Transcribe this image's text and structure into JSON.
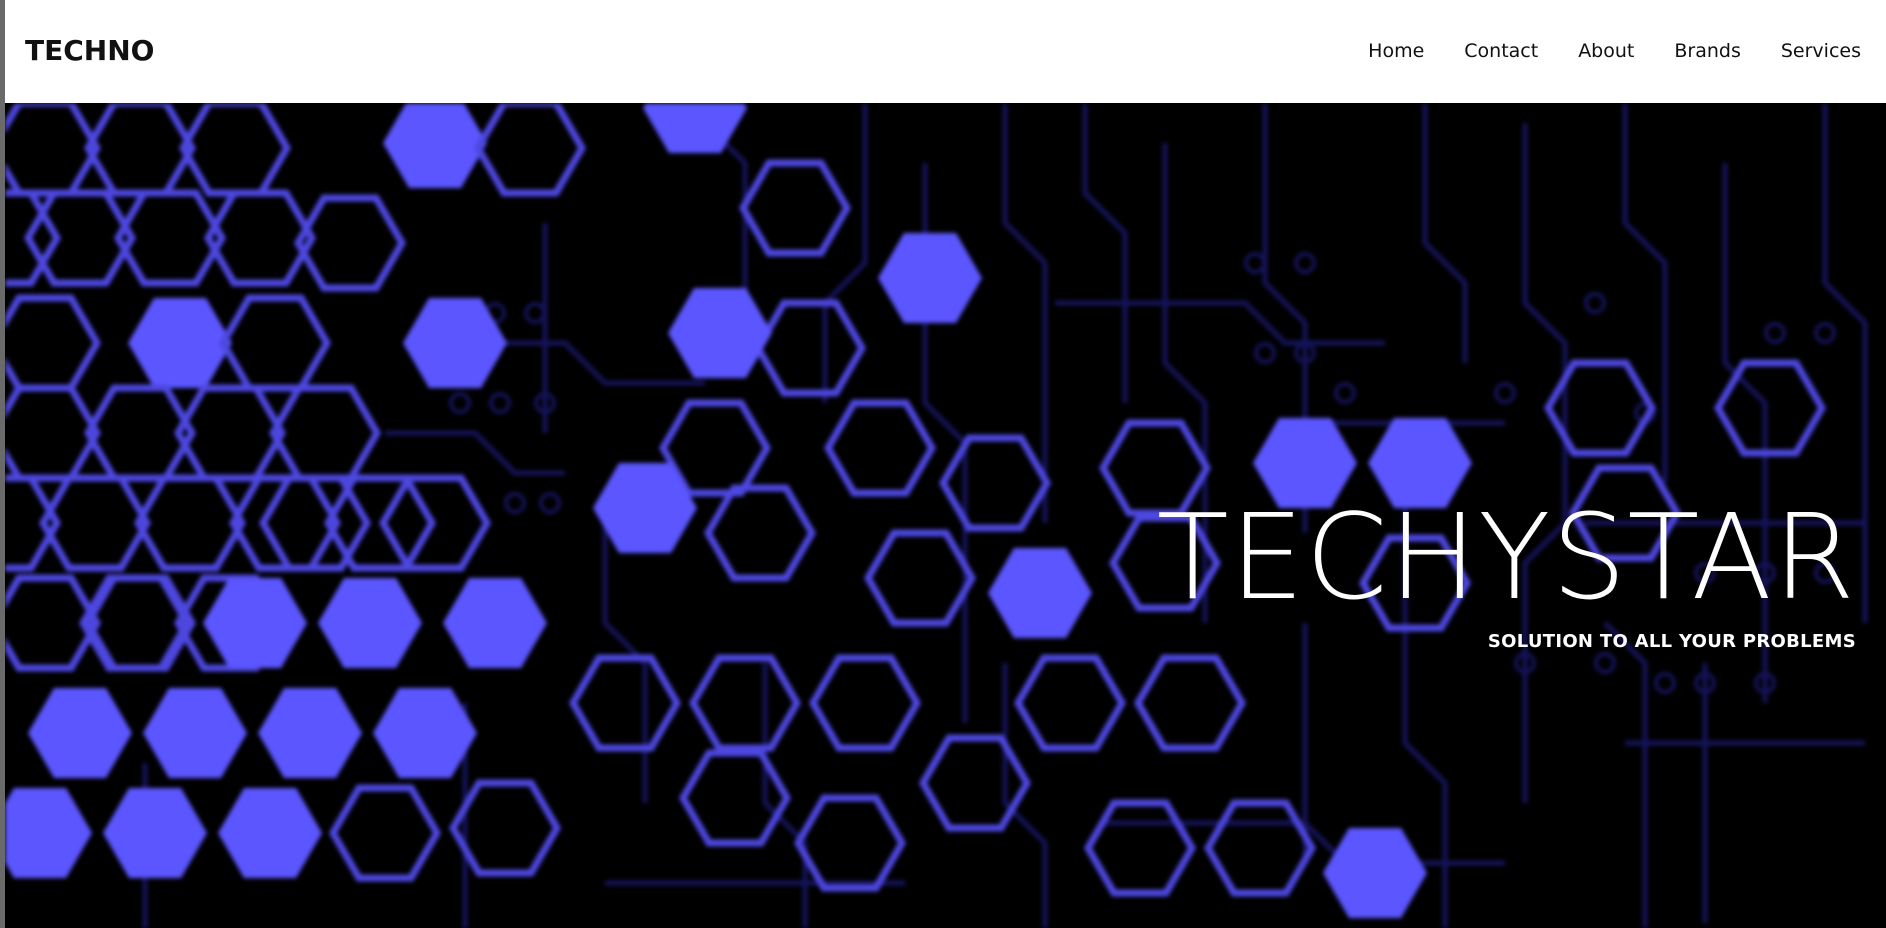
{
  "header": {
    "brand": "TECHNO",
    "nav": [
      {
        "label": "Home"
      },
      {
        "label": "Contact"
      },
      {
        "label": "About"
      },
      {
        "label": "Brands"
      },
      {
        "label": "Services"
      }
    ]
  },
  "hero": {
    "title": "TECHYSTAR",
    "subtitle": "SOLUTION TO ALL YOUR PROBLEMS",
    "background": "circuit-hexagon-pattern"
  },
  "colors": {
    "nav_background": "#ffffff",
    "hero_background": "#000000",
    "hex_fill": "#5b56ff",
    "hex_outline": "#4d47e0",
    "circuit_lines": "#15135a",
    "text_light": "#ffffff"
  }
}
